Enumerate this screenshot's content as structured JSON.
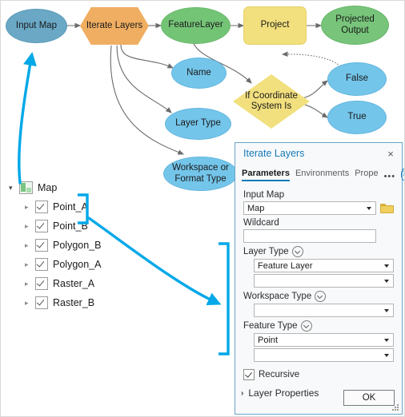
{
  "model": {
    "nodes": [
      {
        "id": "input-map",
        "label": "Input Map",
        "shape": "ellipse",
        "color": "#6aa8c6"
      },
      {
        "id": "iterate-layers",
        "label": "Iterate Layers",
        "shape": "hexagon",
        "color": "#f0ae62"
      },
      {
        "id": "feature-layer",
        "label": "FeatureLayer",
        "shape": "ellipse",
        "color": "#74c476"
      },
      {
        "id": "project",
        "label": "Project",
        "shape": "rounded",
        "color": "#f2e07e"
      },
      {
        "id": "projected-output",
        "label": "Projected\nOutput",
        "shape": "ellipse",
        "color": "#74c476"
      },
      {
        "id": "name",
        "label": "Name",
        "shape": "ellipse",
        "color": "#74c5ea"
      },
      {
        "id": "layer-type",
        "label": "Layer Type",
        "shape": "ellipse",
        "color": "#74c5ea"
      },
      {
        "id": "workspace-format",
        "label": "Workspace or\nFormat Type",
        "shape": "ellipse",
        "color": "#74c5ea"
      },
      {
        "id": "if-coordinate",
        "label": "If Coordinate\nSystem Is",
        "shape": "diamond",
        "color": "#f2e07e"
      },
      {
        "id": "false",
        "label": "False",
        "shape": "ellipse",
        "color": "#74c5ea"
      },
      {
        "id": "true",
        "label": "True",
        "shape": "ellipse",
        "color": "#74c5ea"
      }
    ],
    "node_labels": {
      "input_map": "Input Map",
      "iterate_layers": "Iterate Layers",
      "feature_layer": "FeatureLayer",
      "project": "Project",
      "projected_output_line1": "Projected",
      "projected_output_line2": "Output",
      "name": "Name",
      "layer_type": "Layer Type",
      "workspace_line1": "Workspace or",
      "workspace_line2": "Format Type",
      "if_coordinate_line1": "If Coordinate",
      "if_coordinate_line2": "System Is",
      "false": "False",
      "true": "True"
    }
  },
  "contents_tree": {
    "root": {
      "label": "Map",
      "icon": "map-icon",
      "expander": "expanded-triangle"
    },
    "layers": [
      {
        "label": "Point_A",
        "checked": true,
        "expander": "collapsed-triangle"
      },
      {
        "label": "Point_B",
        "checked": true,
        "expander": "collapsed-triangle"
      },
      {
        "label": "Polygon_B",
        "checked": true,
        "expander": "collapsed-triangle"
      },
      {
        "label": "Polygon_A",
        "checked": true,
        "expander": "collapsed-triangle"
      },
      {
        "label": "Raster_A",
        "checked": true,
        "expander": "collapsed-triangle"
      },
      {
        "label": "Raster_B",
        "checked": true,
        "expander": "collapsed-triangle"
      }
    ]
  },
  "dialog": {
    "title": "Iterate Layers",
    "close_label": "×",
    "tabs": [
      {
        "label": "Parameters",
        "active": true
      },
      {
        "label": "Environments",
        "active": false
      },
      {
        "label": "Prope",
        "active": false
      }
    ],
    "overflow_label": "•••",
    "help_label": "?",
    "fields": {
      "input_map": {
        "label": "Input Map",
        "value": "Map",
        "browse_icon": "folder-icon"
      },
      "wildcard": {
        "label": "Wildcard",
        "value": ""
      },
      "layer_type": {
        "label": "Layer Type",
        "expander_icon": "chevron-down-circle-icon",
        "value": "Feature Layer",
        "second_value": ""
      },
      "workspace_type": {
        "label": "Workspace Type",
        "expander_icon": "chevron-down-circle-icon",
        "value": ""
      },
      "feature_type": {
        "label": "Feature Type",
        "expander_icon": "chevron-down-circle-icon",
        "value": "Point",
        "second_value": ""
      },
      "recursive": {
        "label": "Recursive",
        "checked": true
      },
      "layer_properties": {
        "label": "Layer Properties",
        "expander": "›"
      }
    },
    "ok_label": "OK"
  },
  "annotation": {
    "accent_color": "#00a8e8",
    "map_to_input_arrow": "curved arrow from Map tree item to Input Map node",
    "points_bracket": "bracket around Point_A and Point_B",
    "dialog_bracket": "bracket beside Layer Type / Workspace Type / Feature Type fields"
  }
}
